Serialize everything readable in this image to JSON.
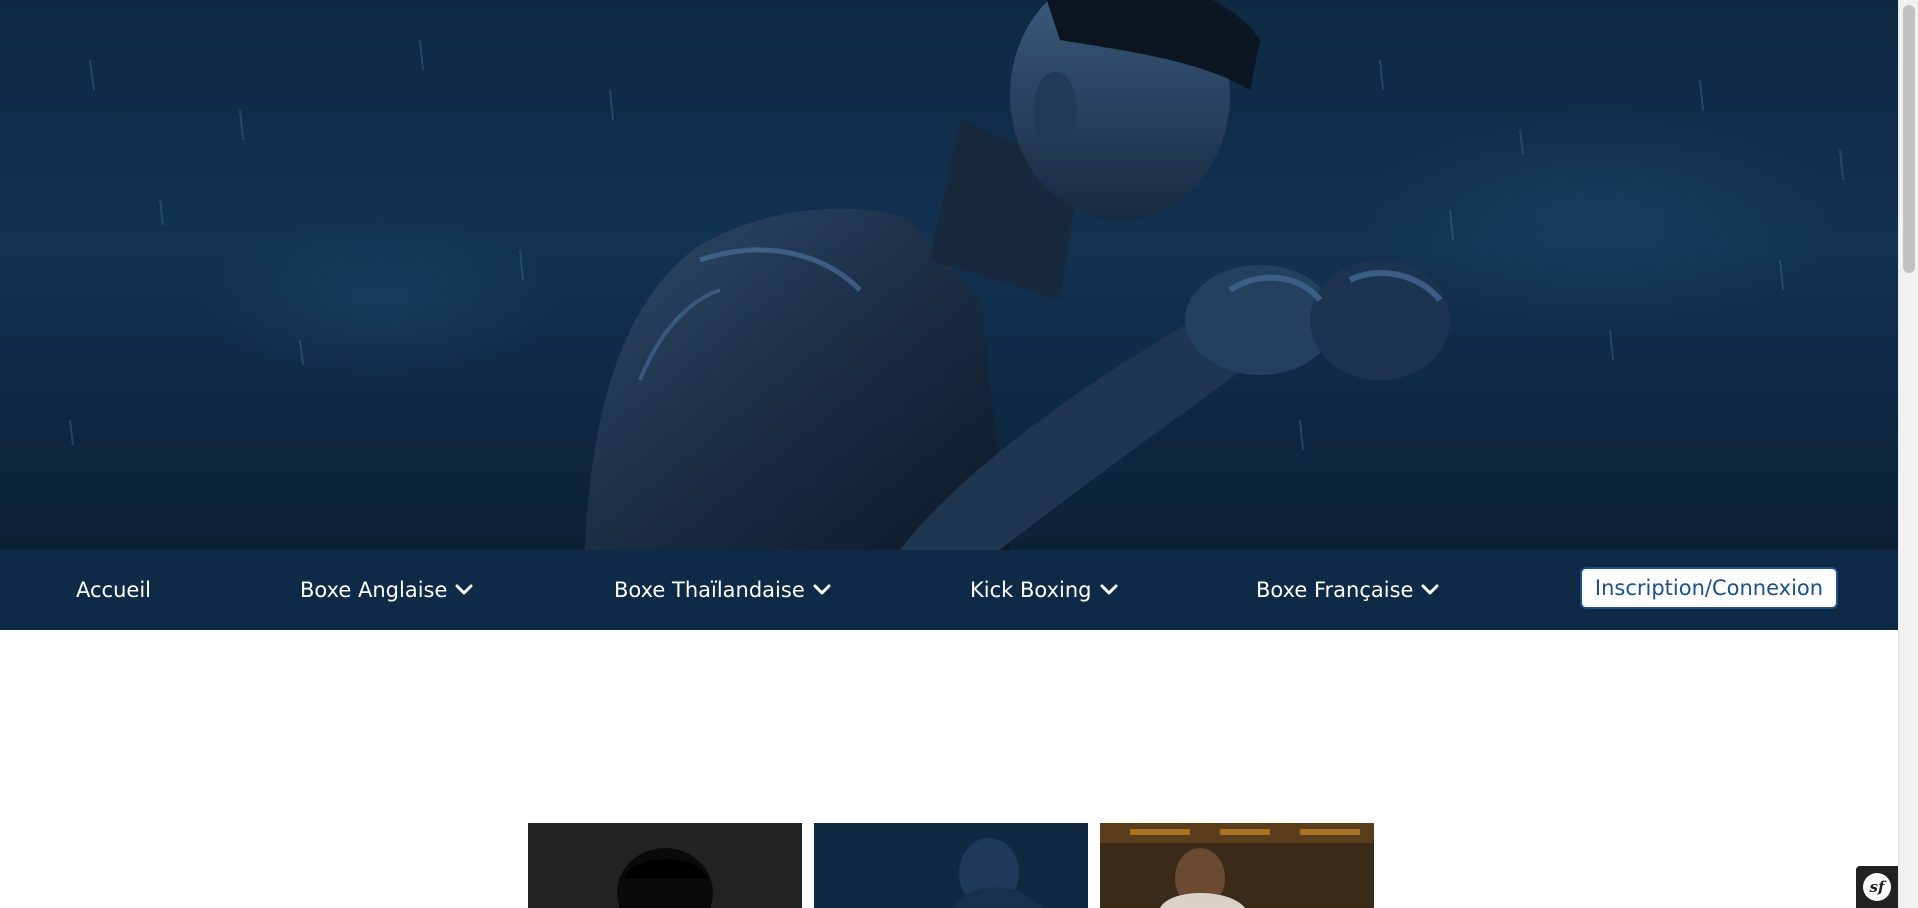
{
  "hero": {
    "image_description": "boxer-in-rain-hero-image"
  },
  "nav": {
    "items": [
      {
        "label": "Accueil",
        "dropdown": false
      },
      {
        "label": "Boxe Anglaise",
        "dropdown": true
      },
      {
        "label": "Boxe Thaïlandaise",
        "dropdown": true
      },
      {
        "label": "Kick Boxing",
        "dropdown": true
      },
      {
        "label": "Boxe Française",
        "dropdown": true
      }
    ],
    "cta_label": "Inscription/Connexion"
  },
  "thumbnails": [
    {
      "name": "boxer-photo-1"
    },
    {
      "name": "boxer-photo-2"
    },
    {
      "name": "boxer-photo-3"
    }
  ],
  "debug_toolbar": {
    "badge_text": "sf"
  },
  "colors": {
    "nav_bg": "#0f2a47",
    "nav_text": "#ffffff",
    "cta_text": "#1e4f86",
    "cta_border": "#1e4f86",
    "hero_bg": "#123250"
  }
}
